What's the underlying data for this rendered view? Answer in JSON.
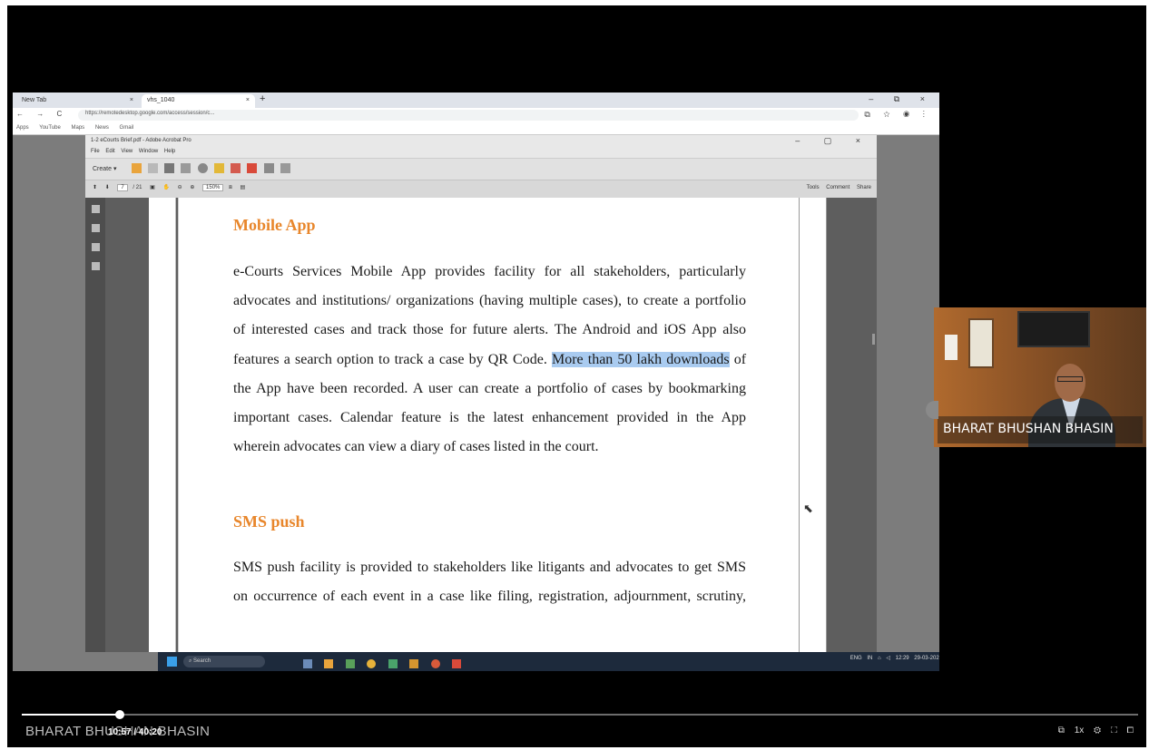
{
  "browser": {
    "tab1": "New Tab",
    "tab2": "vhs_1040",
    "tab_close": "×",
    "new_tab": "+",
    "window_controls": "–  ⧉  ×",
    "nav": "← → C",
    "url": "https://remotedesktop.google.com/access/session/c...",
    "addr_icons": "⧉ ☆ ◉ ⋮",
    "bookmarks": [
      "Apps",
      "YouTube",
      "Maps",
      "News",
      "Gmail"
    ]
  },
  "acrobat": {
    "title": "1-2 eCourts Brief.pdf - Adobe Acrobat Pro",
    "window_controls": "–  ▢  ×",
    "menu": "File Edit View Window Help",
    "create_label": "Create ▾",
    "page_current": "7",
    "page_total": "/ 21",
    "zoom": "150%",
    "tools": "Tools",
    "comment": "Comment",
    "share": "Share"
  },
  "document": {
    "heading1": "Mobile App",
    "para1_lines": [
      "e-Courts Services Mobile App provides facility for all stakeholders, particularly",
      "advocates and institutions/ organizations (having multiple cases), to create a portfolio",
      "of interested cases and track those for future alerts. The Android and iOS App also",
      "features a search option to track a case by QR Code.",
      "More than 50 lakh downloads",
      "of",
      "the App have been recorded. A user can create a portfolio of cases by bookmarking",
      "important cases. Calendar feature is the latest enhancement provided in the App",
      "wherein advocates can view a diary of cases listed in the court."
    ],
    "heading2": "SMS push",
    "para2_lines": [
      "SMS push facility is provided to stakeholders like litigants and advocates to get SMS",
      "on occurrence of each event in a case like filing, registration, adjournment, scrutiny,"
    ]
  },
  "taskbar": {
    "search": "Search",
    "tray_lang": "ENG IN",
    "tray_time": "12:29",
    "tray_date": "29-03-2026"
  },
  "presenter": {
    "name": "BHARAT BHUSHAN BHASIN"
  },
  "player": {
    "speaker_label": "BHARAT BHUSHAN BHASIN",
    "time": "10:57 / 40:20",
    "progress_fraction": 0.088,
    "controls": "⧉ 1x ⚙ ⛶ ⧠"
  }
}
